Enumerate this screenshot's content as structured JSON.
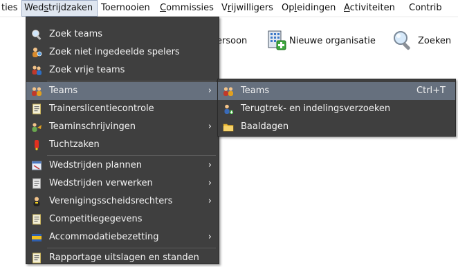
{
  "menubar": {
    "items": [
      {
        "label": "ties",
        "underline_pre": "",
        "underline_char": "",
        "underline_post": "ties"
      },
      {
        "label": "Wedstrijdzaken",
        "underline_pre": "Wed",
        "underline_char": "s",
        "underline_post": "trijdzaken"
      },
      {
        "label": "Toernooien",
        "underline_pre": "",
        "underline_char": "",
        "underline_post": "Toernooien"
      },
      {
        "label": "Commissies",
        "underline_pre": "",
        "underline_char": "C",
        "underline_post": "ommissies"
      },
      {
        "label": "Vrijwilligers",
        "underline_pre": "V",
        "underline_char": "r",
        "underline_post": "ijwilligers"
      },
      {
        "label": "Opleidingen",
        "underline_pre": "Op",
        "underline_char": "l",
        "underline_post": "eidingen"
      },
      {
        "label": "Activiteiten",
        "underline_pre": "",
        "underline_char": "A",
        "underline_post": "ctiviteiten"
      },
      {
        "label": "Contrib",
        "underline_pre": "",
        "underline_char": "",
        "underline_post": "Contrib"
      }
    ]
  },
  "toolbar": {
    "persoon_label": "ersoon",
    "nieuwe_organisatie_label": "Nieuwe organisatie",
    "zoeken_label": "Zoeken"
  },
  "main_menu": {
    "items": [
      {
        "label": "Zoek teams",
        "icon": "magnifier-icon",
        "submenu": false
      },
      {
        "label": "Zoek niet ingedeelde spelers",
        "icon": "players-icon",
        "submenu": false
      },
      {
        "label": "Zoek vrije teams",
        "icon": "people-search-icon",
        "submenu": false
      },
      {
        "label": "Teams",
        "icon": "teams-icon",
        "submenu": true,
        "highlighted": true
      },
      {
        "label": "Trainerslicentiecontrole",
        "icon": "document-icon",
        "submenu": false
      },
      {
        "label": "Teaminschrijvingen",
        "icon": "team-signup-icon",
        "submenu": true
      },
      {
        "label": "Tuchtzaken",
        "icon": "discipline-icon",
        "submenu": false
      },
      {
        "label": "Wedstrijden plannen",
        "icon": "schedule-icon",
        "submenu": true
      },
      {
        "label": "Wedstrijden verwerken",
        "icon": "document-icon",
        "submenu": true
      },
      {
        "label": "Verenigingsscheidsrechters",
        "icon": "referee-icon",
        "submenu": true
      },
      {
        "label": "Competitiegegevens",
        "icon": "document-icon",
        "submenu": false
      },
      {
        "label": "Accommodatiebezetting",
        "icon": "accommodation-icon",
        "submenu": true
      },
      {
        "label": "Rapportage uitslagen en standen",
        "icon": "document-icon",
        "submenu": false
      }
    ]
  },
  "sub_menu": {
    "items": [
      {
        "label": "Teams",
        "shortcut": "Ctrl+T",
        "icon": "teams-icon",
        "highlighted": true
      },
      {
        "label": "Terugtrek- en indelingsverzoeken",
        "shortcut": "",
        "icon": "withdraw-icon"
      },
      {
        "label": "Baaldagen",
        "shortcut": "",
        "icon": "folder-icon"
      }
    ]
  },
  "arrow_glyph": "›"
}
